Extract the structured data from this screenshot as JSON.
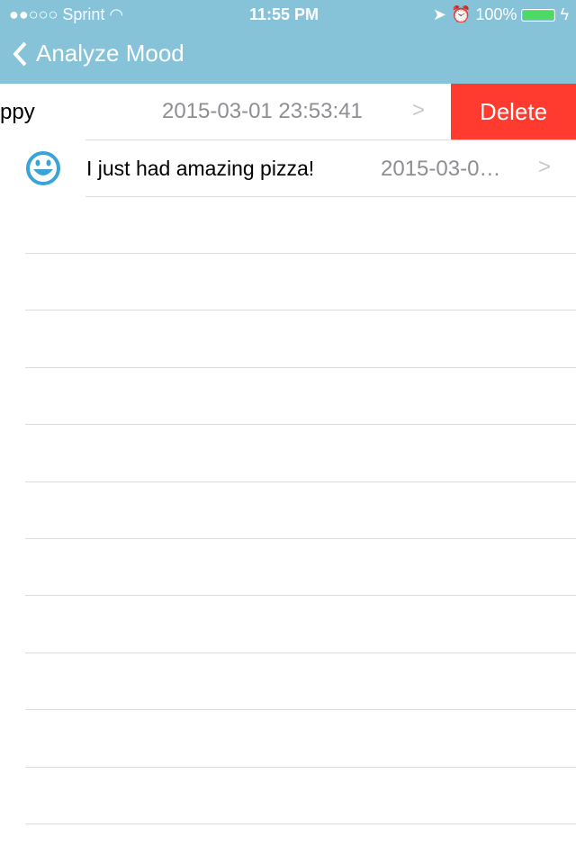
{
  "status_bar": {
    "carrier": "●●○○○ Sprint",
    "time": "11:55 PM",
    "battery": "100%",
    "battery_level": 1.0
  },
  "nav": {
    "back_title": "Analyze Mood",
    "color": "#86c3d9"
  },
  "entries": [
    {
      "text": "ppy",
      "date": "2015-03-01 23:53:41",
      "delete_label": "Delete"
    },
    {
      "text": "I just had amazing pizza!",
      "date": "2015-03-0…",
      "icon": "smiley-icon"
    }
  ],
  "colors": {
    "delete": "#ff3b30",
    "date": "#8e8e93"
  }
}
